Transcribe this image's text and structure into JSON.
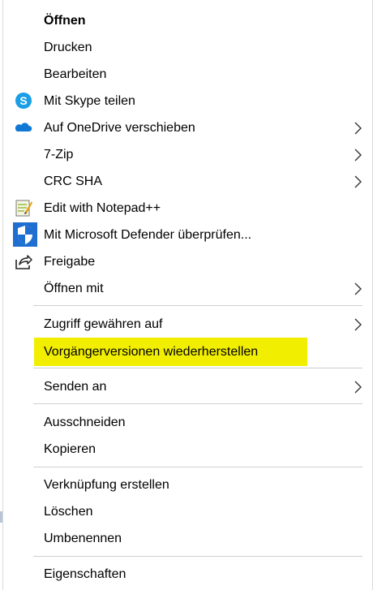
{
  "menu": {
    "items": [
      {
        "label": "Öffnen",
        "icon": null,
        "submenu": false,
        "bold": true
      },
      {
        "label": "Drucken",
        "icon": null,
        "submenu": false
      },
      {
        "label": "Bearbeiten",
        "icon": null,
        "submenu": false
      },
      {
        "label": "Mit Skype teilen",
        "icon": "skype-icon",
        "submenu": false
      },
      {
        "label": "Auf OneDrive verschieben",
        "icon": "onedrive-icon",
        "submenu": true
      },
      {
        "label": "7-Zip",
        "icon": null,
        "submenu": true
      },
      {
        "label": "CRC SHA",
        "icon": null,
        "submenu": true
      },
      {
        "label": "Edit with Notepad++",
        "icon": "notepad-plus-plus-icon",
        "submenu": false
      },
      {
        "label": "Mit Microsoft Defender überprüfen...",
        "icon": "defender-shield-icon",
        "submenu": false
      },
      {
        "label": "Freigabe",
        "icon": "share-icon",
        "submenu": false
      },
      {
        "label": "Öffnen mit",
        "icon": null,
        "submenu": true
      },
      {
        "label": "Zugriff gewähren auf",
        "icon": null,
        "submenu": true
      },
      {
        "label": "Vorgängerversionen wiederherstellen",
        "icon": null,
        "submenu": false,
        "highlighted": true
      },
      {
        "label": "Senden an",
        "icon": null,
        "submenu": true
      },
      {
        "label": "Ausschneiden",
        "icon": null,
        "submenu": false
      },
      {
        "label": "Kopieren",
        "icon": null,
        "submenu": false
      },
      {
        "label": "Verknüpfung erstellen",
        "icon": null,
        "submenu": false
      },
      {
        "label": "Löschen",
        "icon": null,
        "submenu": false
      },
      {
        "label": "Umbenennen",
        "icon": null,
        "submenu": false
      },
      {
        "label": "Eigenschaften",
        "icon": null,
        "submenu": false
      }
    ]
  },
  "colors": {
    "highlight": "#f2ee00",
    "skype": "#1a9ee5",
    "onedrive": "#0f78d4",
    "defender": "#1f6fd1",
    "separator": "#cfcfcf"
  }
}
